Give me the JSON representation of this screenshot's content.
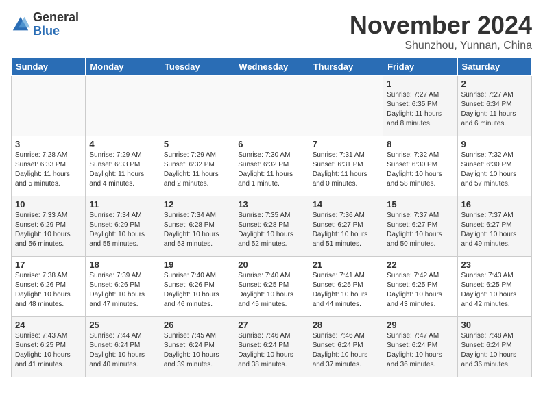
{
  "logo": {
    "general": "General",
    "blue": "Blue"
  },
  "title": "November 2024",
  "location": "Shunzhou, Yunnan, China",
  "headers": [
    "Sunday",
    "Monday",
    "Tuesday",
    "Wednesday",
    "Thursday",
    "Friday",
    "Saturday"
  ],
  "weeks": [
    [
      {
        "day": "",
        "info": ""
      },
      {
        "day": "",
        "info": ""
      },
      {
        "day": "",
        "info": ""
      },
      {
        "day": "",
        "info": ""
      },
      {
        "day": "",
        "info": ""
      },
      {
        "day": "1",
        "info": "Sunrise: 7:27 AM\nSunset: 6:35 PM\nDaylight: 11 hours and 8 minutes."
      },
      {
        "day": "2",
        "info": "Sunrise: 7:27 AM\nSunset: 6:34 PM\nDaylight: 11 hours and 6 minutes."
      }
    ],
    [
      {
        "day": "3",
        "info": "Sunrise: 7:28 AM\nSunset: 6:33 PM\nDaylight: 11 hours and 5 minutes."
      },
      {
        "day": "4",
        "info": "Sunrise: 7:29 AM\nSunset: 6:33 PM\nDaylight: 11 hours and 4 minutes."
      },
      {
        "day": "5",
        "info": "Sunrise: 7:29 AM\nSunset: 6:32 PM\nDaylight: 11 hours and 2 minutes."
      },
      {
        "day": "6",
        "info": "Sunrise: 7:30 AM\nSunset: 6:32 PM\nDaylight: 11 hours and 1 minute."
      },
      {
        "day": "7",
        "info": "Sunrise: 7:31 AM\nSunset: 6:31 PM\nDaylight: 11 hours and 0 minutes."
      },
      {
        "day": "8",
        "info": "Sunrise: 7:32 AM\nSunset: 6:30 PM\nDaylight: 10 hours and 58 minutes."
      },
      {
        "day": "9",
        "info": "Sunrise: 7:32 AM\nSunset: 6:30 PM\nDaylight: 10 hours and 57 minutes."
      }
    ],
    [
      {
        "day": "10",
        "info": "Sunrise: 7:33 AM\nSunset: 6:29 PM\nDaylight: 10 hours and 56 minutes."
      },
      {
        "day": "11",
        "info": "Sunrise: 7:34 AM\nSunset: 6:29 PM\nDaylight: 10 hours and 55 minutes."
      },
      {
        "day": "12",
        "info": "Sunrise: 7:34 AM\nSunset: 6:28 PM\nDaylight: 10 hours and 53 minutes."
      },
      {
        "day": "13",
        "info": "Sunrise: 7:35 AM\nSunset: 6:28 PM\nDaylight: 10 hours and 52 minutes."
      },
      {
        "day": "14",
        "info": "Sunrise: 7:36 AM\nSunset: 6:27 PM\nDaylight: 10 hours and 51 minutes."
      },
      {
        "day": "15",
        "info": "Sunrise: 7:37 AM\nSunset: 6:27 PM\nDaylight: 10 hours and 50 minutes."
      },
      {
        "day": "16",
        "info": "Sunrise: 7:37 AM\nSunset: 6:27 PM\nDaylight: 10 hours and 49 minutes."
      }
    ],
    [
      {
        "day": "17",
        "info": "Sunrise: 7:38 AM\nSunset: 6:26 PM\nDaylight: 10 hours and 48 minutes."
      },
      {
        "day": "18",
        "info": "Sunrise: 7:39 AM\nSunset: 6:26 PM\nDaylight: 10 hours and 47 minutes."
      },
      {
        "day": "19",
        "info": "Sunrise: 7:40 AM\nSunset: 6:26 PM\nDaylight: 10 hours and 46 minutes."
      },
      {
        "day": "20",
        "info": "Sunrise: 7:40 AM\nSunset: 6:25 PM\nDaylight: 10 hours and 45 minutes."
      },
      {
        "day": "21",
        "info": "Sunrise: 7:41 AM\nSunset: 6:25 PM\nDaylight: 10 hours and 44 minutes."
      },
      {
        "day": "22",
        "info": "Sunrise: 7:42 AM\nSunset: 6:25 PM\nDaylight: 10 hours and 43 minutes."
      },
      {
        "day": "23",
        "info": "Sunrise: 7:43 AM\nSunset: 6:25 PM\nDaylight: 10 hours and 42 minutes."
      }
    ],
    [
      {
        "day": "24",
        "info": "Sunrise: 7:43 AM\nSunset: 6:25 PM\nDaylight: 10 hours and 41 minutes."
      },
      {
        "day": "25",
        "info": "Sunrise: 7:44 AM\nSunset: 6:24 PM\nDaylight: 10 hours and 40 minutes."
      },
      {
        "day": "26",
        "info": "Sunrise: 7:45 AM\nSunset: 6:24 PM\nDaylight: 10 hours and 39 minutes."
      },
      {
        "day": "27",
        "info": "Sunrise: 7:46 AM\nSunset: 6:24 PM\nDaylight: 10 hours and 38 minutes."
      },
      {
        "day": "28",
        "info": "Sunrise: 7:46 AM\nSunset: 6:24 PM\nDaylight: 10 hours and 37 minutes."
      },
      {
        "day": "29",
        "info": "Sunrise: 7:47 AM\nSunset: 6:24 PM\nDaylight: 10 hours and 36 minutes."
      },
      {
        "day": "30",
        "info": "Sunrise: 7:48 AM\nSunset: 6:24 PM\nDaylight: 10 hours and 36 minutes."
      }
    ]
  ]
}
